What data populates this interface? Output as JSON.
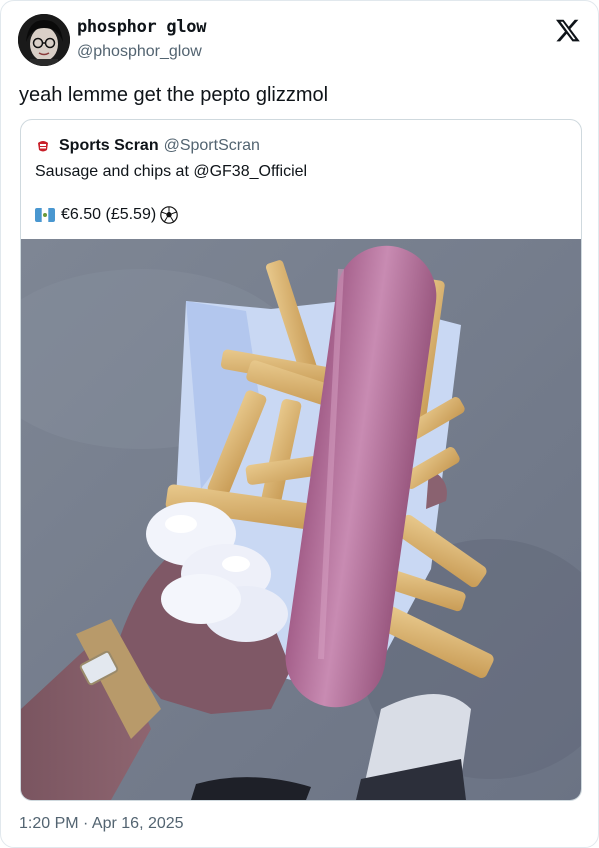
{
  "author": {
    "display_name": "phosphor glow",
    "handle": "@phosphor_glow",
    "avatar_icon": "avatar-portrait-icon"
  },
  "platform_icon": "x-logo-icon",
  "tweet": {
    "text": "yeah lemme get the pepto glizzmol"
  },
  "quoted": {
    "author_icon": "sports-scran-logo-icon",
    "display_name": "Sports Scran",
    "handle": "@SportScran",
    "text": "Sausage and chips at @GF38_Officiel",
    "price_text": "€6.50 (£5.59)",
    "price_prefix_icon": "flag-guatemala-icon",
    "price_suffix_icon": "soccer-ball-icon",
    "image_icon": "sausage-and-chips-photo"
  },
  "meta": {
    "timestamp": "1:20 PM · Apr 16, 2025"
  }
}
